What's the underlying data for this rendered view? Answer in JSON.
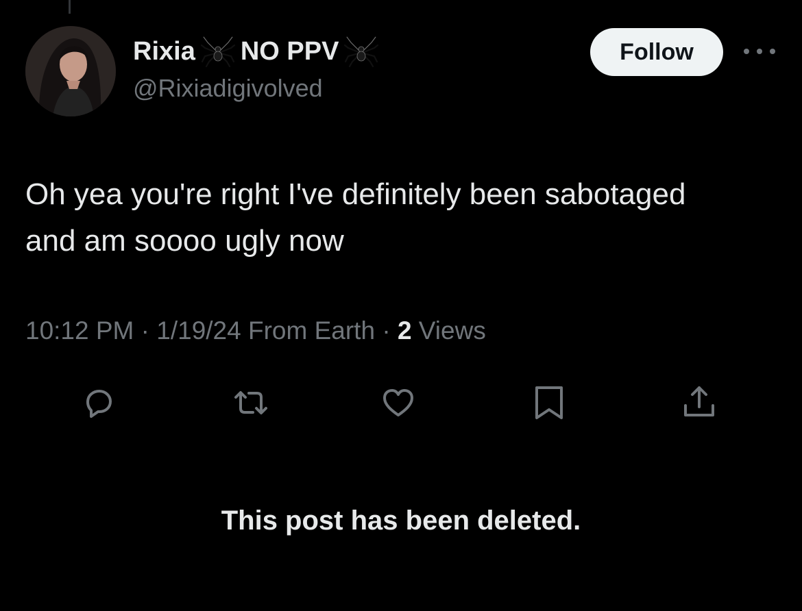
{
  "tweet": {
    "author": {
      "display_name": "Rixia",
      "display_suffix": "NO PPV",
      "handle": "@Rixiadigivolved",
      "name_emoji": "spider"
    },
    "follow_label": "Follow",
    "text": "Oh yea you're right I've definitely been sabotaged and am soooo ugly now",
    "time": "10:12 PM",
    "date": "1/19/24",
    "source": "From Earth",
    "views_count": "2",
    "views_label": "Views",
    "separator": "·"
  },
  "actions": {
    "icons": [
      "reply-icon",
      "retweet-icon",
      "like-icon",
      "bookmark-icon",
      "share-icon"
    ]
  },
  "deleted_notice": "This post has been deleted.",
  "colors": {
    "background": "#000000",
    "primary_text": "#e7e9ea",
    "secondary_text": "#71767b",
    "follow_bg": "#eff3f4"
  }
}
